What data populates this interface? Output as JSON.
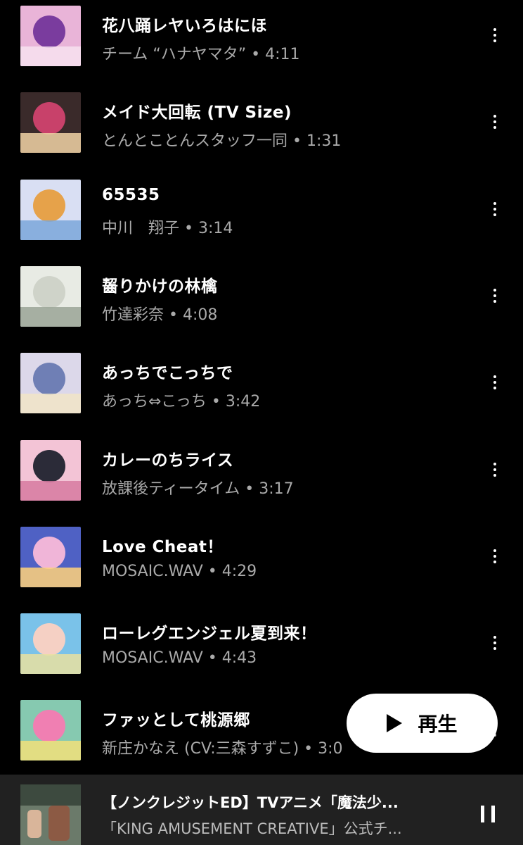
{
  "tracks": [
    {
      "title": "花八踊レヤいろはにほ",
      "subtitle": "チーム “ハナヤマタ” • 4:11",
      "cover": {
        "bg": "#e9b4d8",
        "c1": "#7a3c9e",
        "c2": "#f7e2f0"
      }
    },
    {
      "title": "メイド大回転 (TV Size)",
      "subtitle": "とんとことんスタッフ一同 • 1:31",
      "cover": {
        "bg": "#3a2a2a",
        "c1": "#c8416a",
        "c2": "#f2d3a6"
      }
    },
    {
      "title": "65535",
      "subtitle": "中川　翔子 • 3:14",
      "cover": {
        "bg": "#d9dff3",
        "c1": "#e6a24a",
        "c2": "#7aa7d9"
      }
    },
    {
      "title": "齧りかけの林檎",
      "subtitle": "竹達彩奈 • 4:08",
      "cover": {
        "bg": "#e8ebe4",
        "c1": "#cfd3c9",
        "c2": "#9aa596"
      }
    },
    {
      "title": "あっちでこっちで",
      "subtitle": "あっち⇔こっち • 3:42",
      "cover": {
        "bg": "#dcd8ea",
        "c1": "#6f7fb5",
        "c2": "#f1e5c7"
      }
    },
    {
      "title": "カレーのちライス",
      "subtitle": "放課後ティータイム • 3:17",
      "cover": {
        "bg": "#f3c4d6",
        "c1": "#2b2b38",
        "c2": "#d67aa0"
      }
    },
    {
      "title": "Love Cheat！",
      "subtitle": "MOSAIC.WAV • 4:29",
      "cover": {
        "bg": "#4f61c4",
        "c1": "#f0b5d8",
        "c2": "#ffd27a"
      }
    },
    {
      "title": "ローレグエンジェル夏到来！",
      "subtitle": "MOSAIC.WAV • 4:43",
      "cover": {
        "bg": "#7ac2e9",
        "c1": "#f5d0c4",
        "c2": "#e9e0a0"
      }
    },
    {
      "title": "ファッとして桃源郷",
      "subtitle": "新庄かなえ (CV:三森すずこ) • 3:0",
      "cover": {
        "bg": "#86c9b0",
        "c1": "#f07fb2",
        "c2": "#f2e07a"
      }
    }
  ],
  "play_button": {
    "label": "再生",
    "icon": "play-icon"
  },
  "now_playing": {
    "title": "【ノンクレジットED】TVアニメ「魔法少...",
    "subtitle": "「KING AMUSEMENT CREATIVE」公式チ...",
    "control_icon": "pause-icon"
  }
}
